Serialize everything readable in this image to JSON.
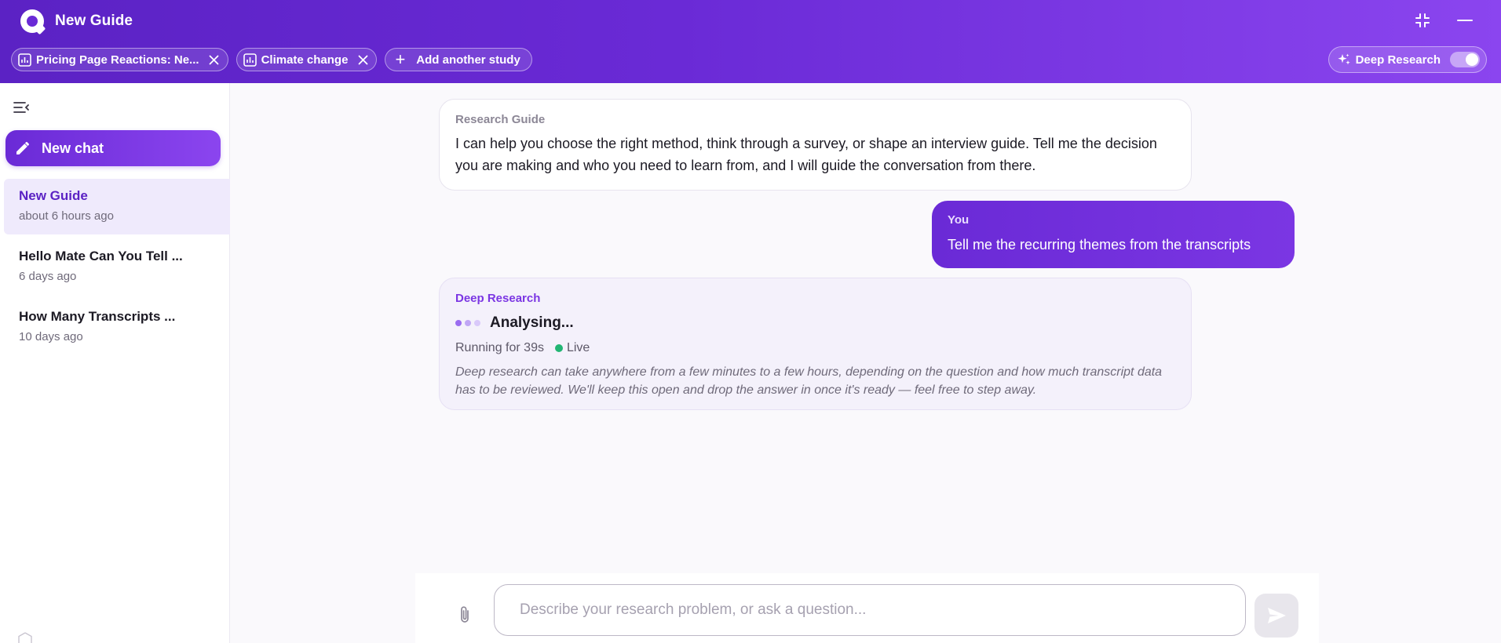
{
  "header": {
    "app_title": "New Guide",
    "tabs": [
      {
        "label": "Pricing Page Reactions: Ne...",
        "icon": "bar-chart-icon"
      },
      {
        "label": "Climate change",
        "icon": "bar-chart-icon"
      }
    ],
    "add_study_label": "Add another study",
    "deep_research": {
      "label": "Deep Research",
      "enabled": true
    }
  },
  "sidebar": {
    "new_chat_label": "New chat",
    "chats": [
      {
        "title": "New Guide",
        "time": "about 6 hours ago",
        "active": true
      },
      {
        "title": "Hello Mate Can You Tell ...",
        "time": "6 days ago",
        "active": false
      },
      {
        "title": "How Many Transcripts ...",
        "time": "10 days ago",
        "active": false
      }
    ]
  },
  "messages": {
    "guide": {
      "label": "Research Guide",
      "body": "I can help you choose the right method, think through a survey, or shape an interview guide. Tell me the decision you are making and who you need to learn from, and I will guide the conversation from there."
    },
    "user": {
      "label": "You",
      "body": "Tell me the recurring themes from the transcripts"
    },
    "deep": {
      "label": "Deep Research",
      "status": "Analysing...",
      "running": "Running for 39s",
      "live": "Live",
      "note": "Deep research can take anywhere from a few minutes to a few hours, depending on the question and how much transcript data has to be reviewed. We'll keep this open and drop the answer in once it's ready — feel free to step away."
    }
  },
  "composer": {
    "placeholder": "Describe your research problem, or ask a question...",
    "value": ""
  },
  "colors": {
    "brand": "#6a2ad6",
    "brand_light": "#8b45ef",
    "live": "#22b573"
  }
}
